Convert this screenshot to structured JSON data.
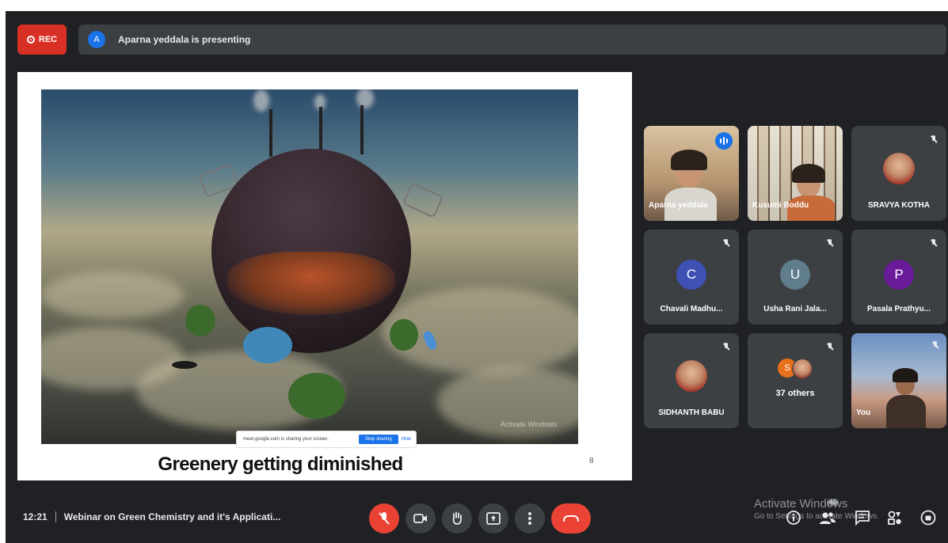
{
  "topbar": {
    "rec_label": "REC",
    "presenter_initial": "A",
    "presenting_text": "Aparna yeddala is presenting"
  },
  "slide": {
    "title": "Greenery getting diminished",
    "page_number": "8",
    "watermark_text": "Activate Windows",
    "share_pill": {
      "message": "meet.google.com is sharing your screen.",
      "stop_label": "Stop sharing",
      "hide_label": "Hide"
    }
  },
  "participants": [
    {
      "name": "Aparna yeddala",
      "type": "video",
      "speaking": true
    },
    {
      "name": "Kusumi Boddu",
      "type": "video",
      "muted": false
    },
    {
      "name": "SRAVYA KOTHA",
      "type": "photo",
      "muted": true
    },
    {
      "name": "Chavali Madhu...",
      "type": "initial",
      "initial": "C",
      "color": "#3f51b5",
      "muted": true
    },
    {
      "name": "Usha Rani Jala...",
      "type": "initial",
      "initial": "U",
      "color": "#607d8b",
      "muted": true
    },
    {
      "name": "Pasala Prathyu...",
      "type": "initial",
      "initial": "P",
      "color": "#6a1b9a",
      "muted": true
    },
    {
      "name": "SIDHANTH BABU",
      "type": "photo",
      "muted": true
    },
    {
      "name": "37 others",
      "type": "others",
      "initial": "S"
    },
    {
      "name": "You",
      "type": "video",
      "muted": true
    }
  ],
  "bottombar": {
    "time": "12:21",
    "meeting_title": "Webinar on Green Chemistry and it's Applicati...",
    "controls": [
      "mic-off-icon",
      "camera-icon",
      "raise-hand-icon",
      "present-icon",
      "more-options-icon",
      "end-call-icon"
    ],
    "right_icons": [
      "info-icon",
      "people-icon",
      "chat-icon",
      "activities-icon",
      "host-controls-icon"
    ],
    "people_count": "40"
  },
  "os_overlay": {
    "line1": "Activate Windows",
    "line2": "Go to Settings to activate Windows."
  },
  "colors": {
    "background": "#202124",
    "rec_red": "#d93025",
    "end_call_red": "#ea4335",
    "accent_blue": "#1a73e8"
  }
}
